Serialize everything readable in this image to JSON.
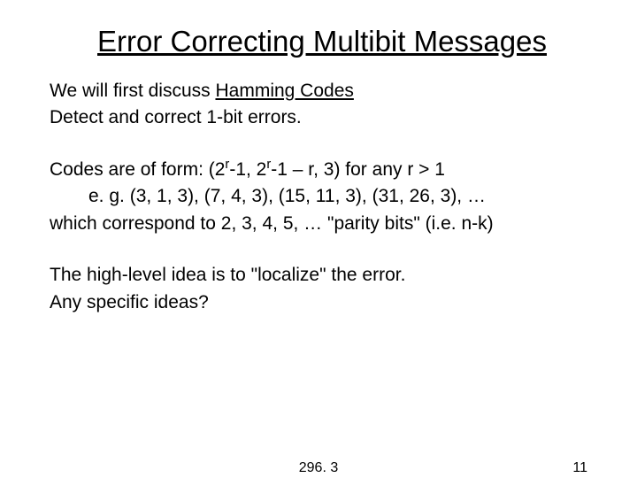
{
  "title": "Error Correcting Multibit Messages",
  "intro": {
    "line1_a": "We will first discuss ",
    "line1_b": "Hamming Codes",
    "line2": "Detect and correct 1-bit errors."
  },
  "codes": {
    "line1_a": "Codes are of form: (2",
    "line1_sup1": "r",
    "line1_b": "-1, 2",
    "line1_sup2": "r",
    "line1_c": "-1 – r, 3) for any r > 1",
    "line2": "e. g. (3, 1, 3), (7, 4, 3), (15, 11, 3), (31, 26, 3), …",
    "line3": "which correspond to 2, 3, 4, 5, … \"parity bits\" (i.e. n-k)"
  },
  "closing": {
    "line1": "The high-level idea is to \"localize\" the error.",
    "line2": "Any specific ideas?"
  },
  "footer": {
    "center": "296. 3",
    "right": "11"
  }
}
